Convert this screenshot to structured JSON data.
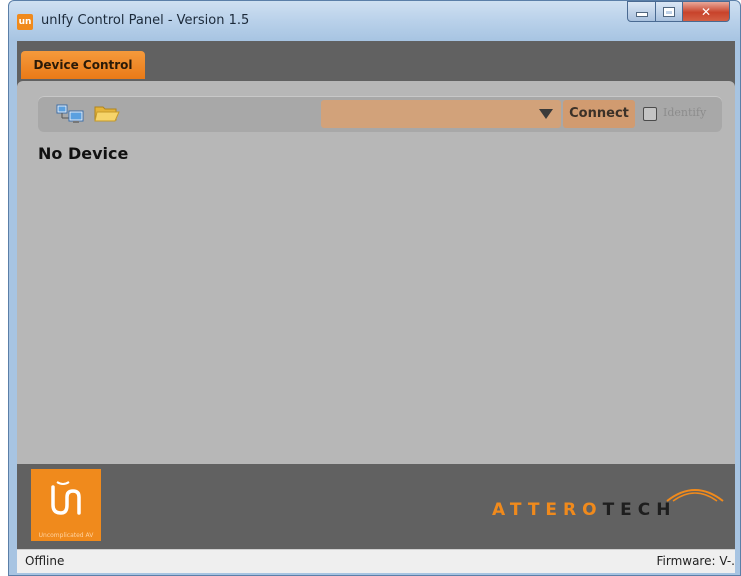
{
  "window": {
    "title": "unIfy Control Panel - Version 1.5",
    "app_icon_text": "un"
  },
  "tabs": [
    {
      "label": "Device Control",
      "active": true
    }
  ],
  "toolbar": {
    "device_select_value": "",
    "connect_label": "Connect",
    "identify_label": "Identify",
    "identify_checked": false
  },
  "main": {
    "status_heading": "No Device"
  },
  "branding": {
    "unify_tagline": "Uncomplicated AV",
    "atterotech_part1": "ATTERO",
    "atterotech_part2": "TECH",
    "accent_color": "#f08a1c"
  },
  "statusbar": {
    "connection": "Offline",
    "firmware": "Firmware: V-."
  }
}
